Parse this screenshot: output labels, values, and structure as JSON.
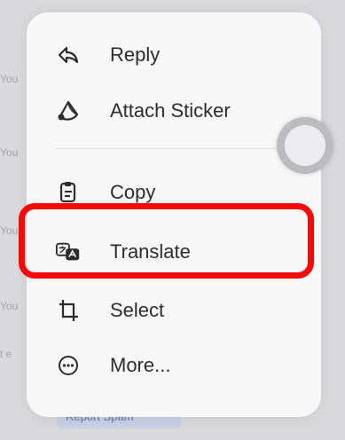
{
  "background": {
    "snippets": [
      "You",
      "You",
      "You",
      "You",
      "t e"
    ],
    "report_spam_label": "Report Spam"
  },
  "menu": {
    "items": [
      {
        "label": "Reply",
        "icon": "reply-icon"
      },
      {
        "label": "Attach Sticker",
        "icon": "sticker-icon"
      },
      {
        "label": "Copy",
        "icon": "copy-icon"
      },
      {
        "label": "Translate",
        "icon": "translate-icon"
      },
      {
        "label": "Select",
        "icon": "select-crop-icon"
      },
      {
        "label": "More...",
        "icon": "more-ellipsis-icon"
      }
    ]
  },
  "colors": {
    "highlight": "#f50a0a",
    "menu_background": "#f7f7f8",
    "text": "#2d2d30"
  }
}
